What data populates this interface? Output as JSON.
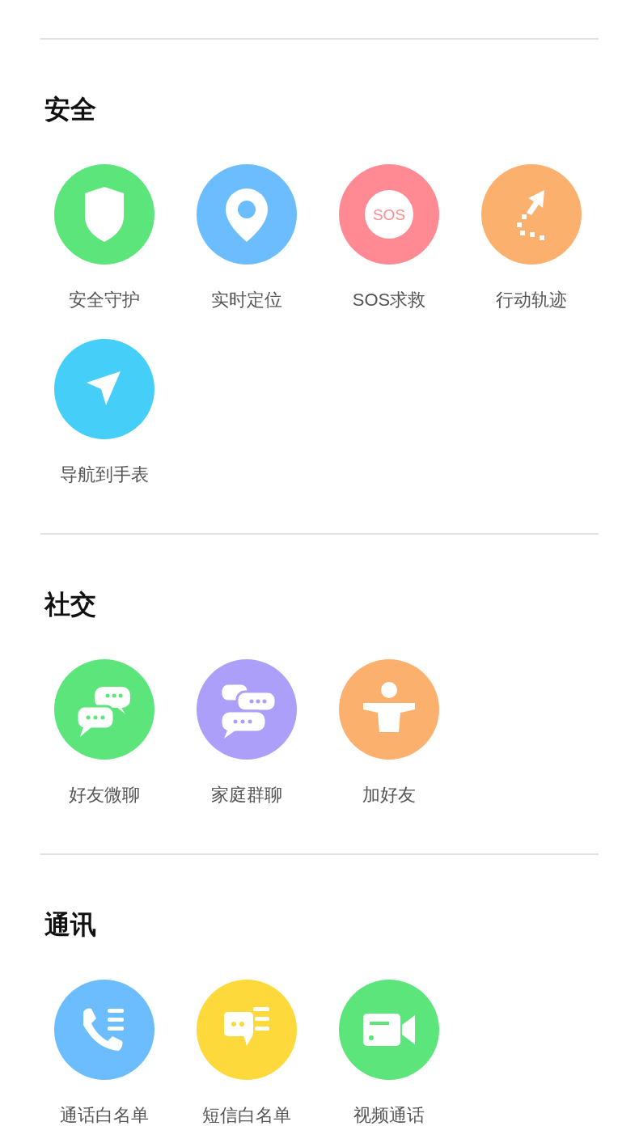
{
  "sections": [
    {
      "title": "安全",
      "items": [
        {
          "label": "安全守护",
          "kind": "shield",
          "color": "#5ce57a"
        },
        {
          "label": "实时定位",
          "kind": "pin",
          "color": "#6cbdfd"
        },
        {
          "label": "SOS求救",
          "kind": "sos",
          "icon_text": "SOS",
          "color": "#ff8a94"
        },
        {
          "label": "行动轨迹",
          "kind": "track",
          "color": "#fcb06e"
        },
        {
          "label": "导航到手表",
          "kind": "navigate",
          "color": "#45cff8"
        }
      ]
    },
    {
      "title": "社交",
      "items": [
        {
          "label": "好友微聊",
          "kind": "chat",
          "color": "#5ce57a"
        },
        {
          "label": "家庭群聊",
          "kind": "groupchat",
          "color": "#ac9ffa"
        },
        {
          "label": "加好友",
          "kind": "person",
          "color": "#fcb06e"
        }
      ]
    },
    {
      "title": "通讯",
      "items": [
        {
          "label": "通话白名单",
          "kind": "phone",
          "color": "#6cbdfd"
        },
        {
          "label": "短信白名单",
          "kind": "message",
          "color": "#fdd93b"
        },
        {
          "label": "视频通话",
          "kind": "video",
          "color": "#5ce57a"
        }
      ]
    }
  ]
}
